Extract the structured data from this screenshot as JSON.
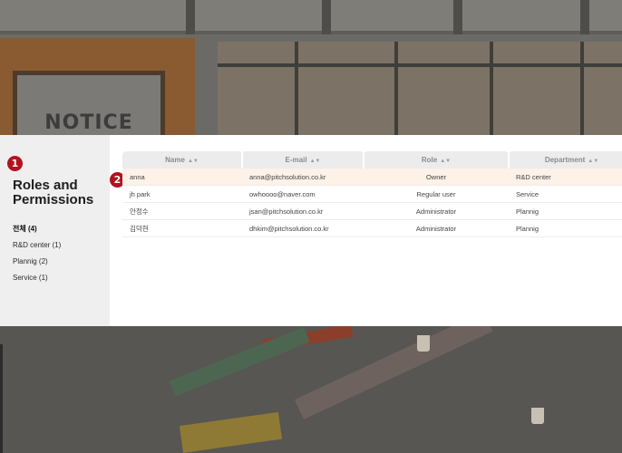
{
  "background": {
    "sign_text": "NOTICE"
  },
  "sidebar": {
    "step_badge": "1",
    "title": "Roles and Permissions",
    "filters": [
      {
        "label": "전체 (4)",
        "active": true
      },
      {
        "label": "R&D center (1)",
        "active": false
      },
      {
        "label": "Plannig (2)",
        "active": false
      },
      {
        "label": "Service (1)",
        "active": false
      }
    ]
  },
  "table": {
    "step_badge": "2",
    "sort_icon": "sort-icon",
    "columns": [
      "Name",
      "E-mail",
      "Role",
      "Department"
    ],
    "rows": [
      {
        "name": "anna",
        "email": "anna@pitchsolution.co.kr",
        "role": "Owner",
        "department": "R&D center",
        "selected": true
      },
      {
        "name": "jh park",
        "email": "owhoooo@naver.com",
        "role": "Regular user",
        "department": "Service",
        "selected": false
      },
      {
        "name": "안정수",
        "email": "jsan@pitchsolution.co.kr",
        "role": "Administrator",
        "department": "Plannig",
        "selected": false
      },
      {
        "name": "김덕현",
        "email": "dhkim@pitchsolution.co.kr",
        "role": "Administrator",
        "department": "Plannig",
        "selected": false
      }
    ]
  },
  "colors": {
    "badge": "#b3121f",
    "selected_row": "#fdf1e8",
    "sidebar_bg": "#efefef",
    "header_bg": "#ececec"
  }
}
